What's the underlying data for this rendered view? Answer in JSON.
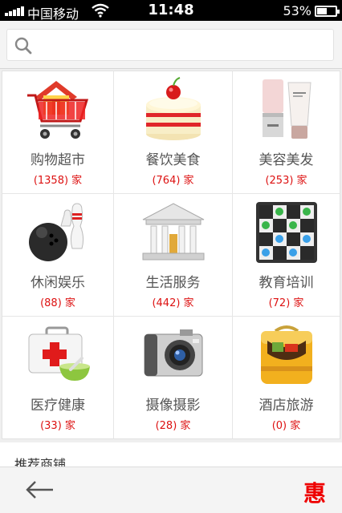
{
  "status_bar": {
    "carrier": "中国移动",
    "time": "11:48",
    "battery_percent": "53%",
    "battery_level": 0.53
  },
  "search": {
    "placeholder": ""
  },
  "categories": [
    {
      "name": "购物超市",
      "count": "(1358) 家",
      "icon": "shopping-cart-icon"
    },
    {
      "name": "餐饮美食",
      "count": "(764) 家",
      "icon": "cake-icon"
    },
    {
      "name": "美容美发",
      "count": "(253) 家",
      "icon": "cosmetics-icon"
    },
    {
      "name": "休闲娱乐",
      "count": "(88) 家",
      "icon": "bowling-icon"
    },
    {
      "name": "生活服务",
      "count": "(442) 家",
      "icon": "bank-icon"
    },
    {
      "name": "教育培训",
      "count": "(72) 家",
      "icon": "checkers-board-icon"
    },
    {
      "name": "医疗健康",
      "count": "(33) 家",
      "icon": "first-aid-kit-icon"
    },
    {
      "name": "摄像摄影",
      "count": "(28) 家",
      "icon": "camera-icon"
    },
    {
      "name": "酒店旅游",
      "count": "(0) 家",
      "icon": "hotel-luggage-icon"
    }
  ],
  "section_peek_title": "推荐商铺",
  "bottom_bar": {
    "logo_text": "惠",
    "back_icon": "back-arrow-icon"
  },
  "colors": {
    "accent_red": "#dd1111",
    "logo_red": "#ee0000"
  }
}
